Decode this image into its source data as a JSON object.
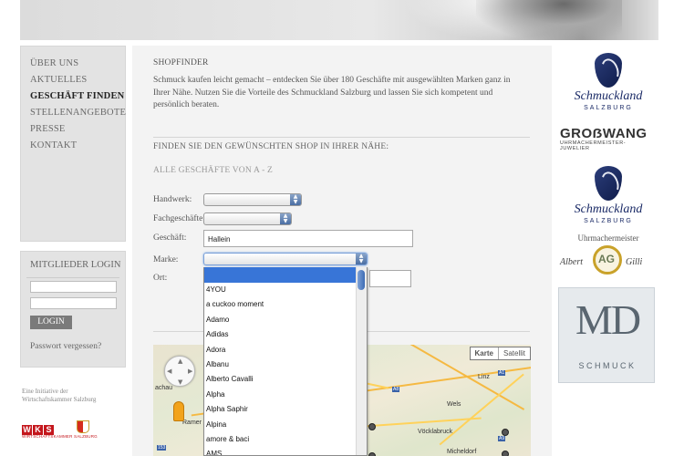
{
  "nav": {
    "items": [
      "ÜBER UNS",
      "AKTUELLES",
      "GESCHÄFT FINDEN",
      "STELLENANGEBOTE",
      "PRESSE",
      "KONTAKT"
    ],
    "active": "GESCHÄFT FINDEN"
  },
  "login": {
    "title": "MITGLIEDER LOGIN",
    "button": "LOGIN",
    "forgot": "Passwort vergessen?"
  },
  "footer": {
    "initiative": "Eine Initiative der Wirtschaftskammer Salzburg",
    "wks_letters": [
      "W",
      "K",
      "S"
    ],
    "wks_sub": "WIRTSCHAFTSKAMMER SALZBURG"
  },
  "shopfinder": {
    "title": "SHOPFINDER",
    "intro": "Schmuck kaufen leicht gemacht – entdecken Sie über 180 Geschäfte mit ausgewählten Marken ganz in Ihrer Nähe. Nutzen Sie die Vorteile des Schmuckland Salzburg und lassen Sie sich kompetent und persönlich beraten.",
    "find_heading": "FINDEN SIE DEN GEWÜNSCHTEN SHOP IN IHRER NÄHE:",
    "all_shops": "ALLE GESCHÄFTE VON A - Z",
    "labels": {
      "handwerk": "Handwerk:",
      "fachgeschaefte": "Fachgeschäfte:",
      "geschaeft": "Geschäft:",
      "marke": "Marke:",
      "ort": "Ort:"
    },
    "geschaeft_value": "Hallein"
  },
  "marke_options": [
    "4YOU",
    "a cuckoo moment",
    "Adamo",
    "Adidas",
    "Adora",
    "Albanu",
    "Alberto Cavalli",
    "Alpha",
    "Alpha Saphir",
    "Alpina",
    "amore & baci",
    "AMS"
  ],
  "map": {
    "type_map": "Karte",
    "type_sat": "Satellit",
    "towns": [
      "Linz",
      "Wels",
      "Vöcklabruck",
      "Micheldorf",
      "achau",
      "Ramer"
    ],
    "badges": [
      "A1",
      "A8",
      "A9",
      "153"
    ],
    "colors": {
      "land": "#e9e3cf",
      "road": "#f5b942",
      "highway_badge": "#3a62a8"
    }
  },
  "brands": {
    "schmuckland": "Schmuckland",
    "schmuckland_city": "SALZBURG",
    "grosswang": "GROẞWANG",
    "grosswang_sub": "UHRMACHERMEISTER-JUWELIER",
    "uhrmachermeister": "Uhrmachermeister",
    "albert": "Albert",
    "gilli": "Gilli",
    "ag": "AG",
    "md": "MD",
    "md_sub": "SCHMUCK"
  },
  "colors": {
    "active_nav": "#222222",
    "dropdown_highlight": "#3875d7",
    "brand_blue": "#1a2a66",
    "wks_red": "#c4161c"
  }
}
